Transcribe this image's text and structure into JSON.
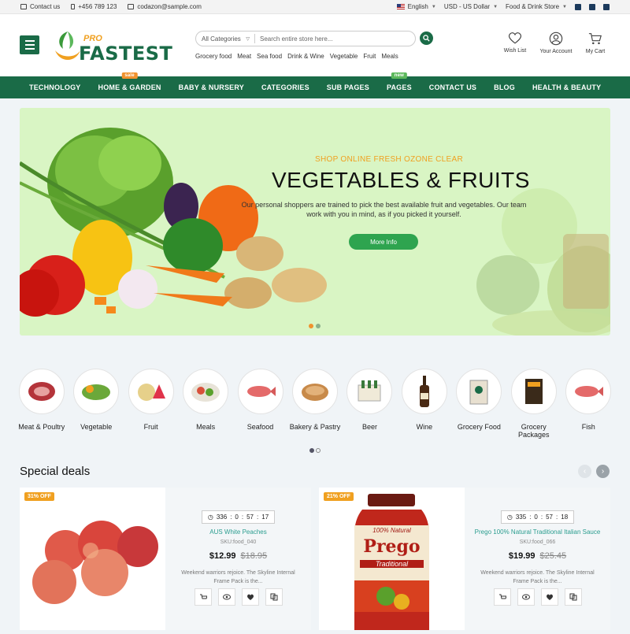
{
  "topbar": {
    "contact": "Contact us",
    "phone": "+456 789 123",
    "email": "codazon@sample.com",
    "language": "English",
    "currency": "USD - US Dollar",
    "store": "Food & Drink Store"
  },
  "header": {
    "logo_pro": "PRO",
    "logo_text": "FASTEST",
    "search_category": "All Categories",
    "search_placeholder": "Search entire store here...",
    "quick_links": [
      "Grocery food",
      "Meat",
      "Sea food",
      "Drink & Wine",
      "Vegetable",
      "Fruit",
      "Meals"
    ],
    "wishlist": "Wish List",
    "account": "Your Account",
    "cart": "My Cart"
  },
  "nav": [
    {
      "label": "TECHNOLOGY",
      "badge": ""
    },
    {
      "label": "HOME & GARDEN",
      "badge": "sale"
    },
    {
      "label": "BABY & NURSERY",
      "badge": ""
    },
    {
      "label": "CATEGORIES",
      "badge": ""
    },
    {
      "label": "SUB PAGES",
      "badge": ""
    },
    {
      "label": "PAGES",
      "badge": "new"
    },
    {
      "label": "CONTACT US",
      "badge": ""
    },
    {
      "label": "BLOG",
      "badge": ""
    },
    {
      "label": "HEALTH & BEAUTY",
      "badge": ""
    }
  ],
  "hero": {
    "subtitle": "SHOP ONLINE FRESH OZONE CLEAR",
    "title": "VEGETABLES & FRUITS",
    "description": "Our personal shoppers are trained to pick the best available fruit and vegetables. Our team work with you in mind, as if you picked it yourself.",
    "button": "More Info"
  },
  "categories": [
    {
      "label": "Meat & Poultry",
      "icon": "meat-icon"
    },
    {
      "label": "Vegetable",
      "icon": "vegetable-icon"
    },
    {
      "label": "Fruit",
      "icon": "fruit-icon"
    },
    {
      "label": "Meals",
      "icon": "meals-icon"
    },
    {
      "label": "Seafood",
      "icon": "seafood-icon"
    },
    {
      "label": "Bakery & Pastry",
      "icon": "bakery-icon"
    },
    {
      "label": "Beer",
      "icon": "beer-icon"
    },
    {
      "label": "Wine",
      "icon": "wine-icon"
    },
    {
      "label": "Grocery Food",
      "icon": "grocery-food-icon"
    },
    {
      "label": "Grocery Packages",
      "icon": "grocery-packages-icon"
    },
    {
      "label": "Fish",
      "icon": "fish-icon"
    }
  ],
  "deals": {
    "title": "Special deals",
    "products": [
      {
        "discount": "31% OFF",
        "timer": [
          "336",
          "0",
          "57",
          "17"
        ],
        "name": "AUS White Peaches",
        "sku": "SKU:food_040",
        "price": "$12.99",
        "old_price": "$18.95",
        "desc": "Weekend warriors rejoice. The Skyline Internal Frame Pack is the..."
      },
      {
        "discount": "21% OFF",
        "timer": [
          "335",
          "0",
          "57",
          "18"
        ],
        "name": "Prego 100% Natural Traditional Italian Sauce",
        "sku": "SKU:food_066",
        "price": "$19.99",
        "old_price": "$25.45",
        "desc": "Weekend warriors rejoice. The Skyline Internal Frame Pack is the...",
        "jar_label_top": "100% Natural",
        "jar_brand": "Prego",
        "jar_label_bottom": "Traditional"
      }
    ]
  },
  "colors": {
    "primary": "#1a6b47",
    "accent": "#f0a020",
    "button_green": "#2ea44f",
    "hero_bg": "#d9f5c4"
  }
}
